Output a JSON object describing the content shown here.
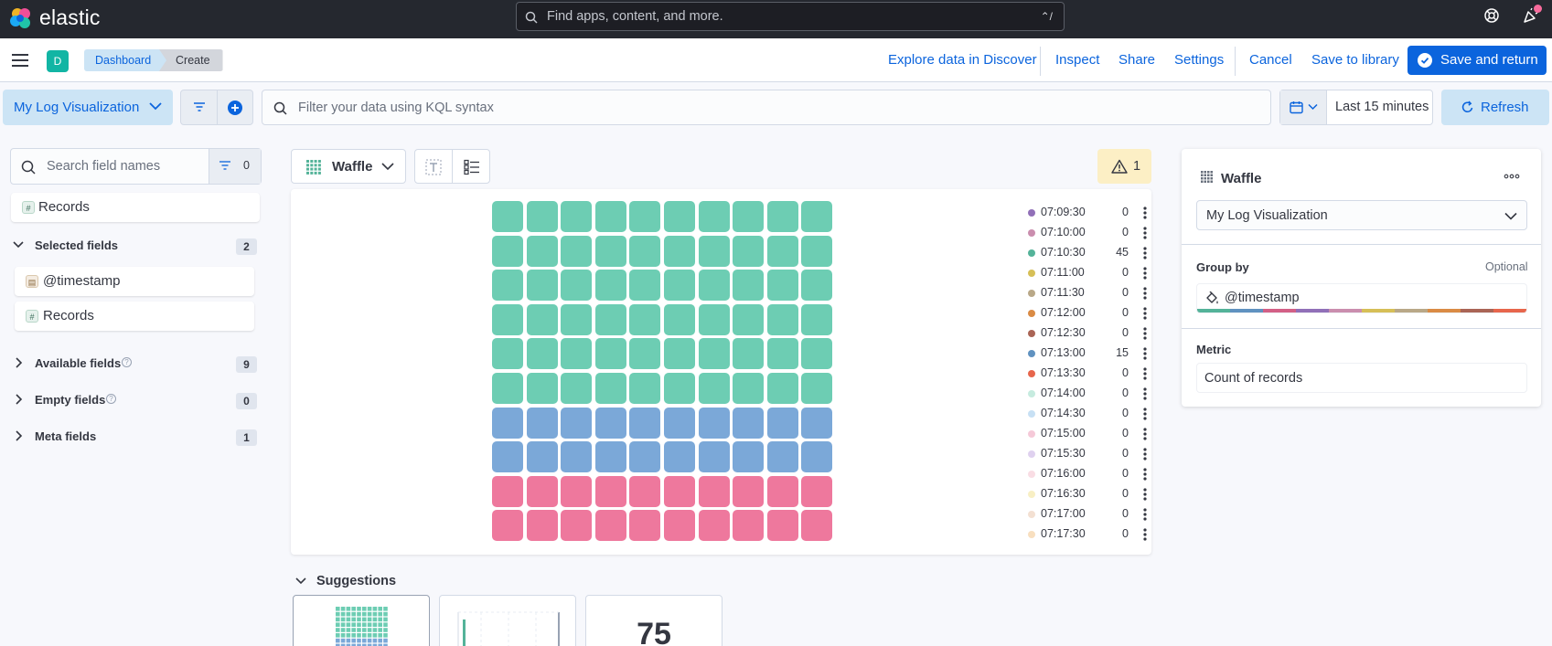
{
  "header": {
    "logo_text": "elastic",
    "search_placeholder": "Find apps, content, and more.",
    "search_shortcut": "⌃/"
  },
  "appbar": {
    "space_initial": "D",
    "breadcrumbs": [
      "Dashboard",
      "Create"
    ],
    "actions": {
      "explore": "Explore data in Discover",
      "inspect": "Inspect",
      "share": "Share",
      "settings": "Settings",
      "cancel": "Cancel",
      "save_library": "Save to library",
      "save_return": "Save and return"
    }
  },
  "querybar": {
    "viz_title": "My Log Visualization",
    "kql_placeholder": "Filter your data using KQL syntax",
    "date_range": "Last 15 minutes",
    "refresh": "Refresh"
  },
  "fields_panel": {
    "search_placeholder": "Search field names",
    "filter_count": "0",
    "records_top": "Records",
    "selected": {
      "label": "Selected fields",
      "count": "2",
      "items": [
        "@timestamp",
        "Records"
      ]
    },
    "available": {
      "label": "Available fields",
      "count": "9"
    },
    "empty": {
      "label": "Empty fields",
      "count": "0"
    },
    "meta": {
      "label": "Meta fields",
      "count": "1"
    }
  },
  "workspace": {
    "chart_type": "Waffle",
    "warnings_count": "1",
    "suggestions_label": "Suggestions",
    "suggestion_metric_value": "75"
  },
  "chart_data": {
    "type": "waffle",
    "grid": [
      10,
      10
    ],
    "legend": [
      {
        "label": "07:09:30",
        "value": 0,
        "color": "#9170b8"
      },
      {
        "label": "07:10:00",
        "value": 0,
        "color": "#ca8eae"
      },
      {
        "label": "07:10:30",
        "value": 45,
        "color": "#54b399"
      },
      {
        "label": "07:11:00",
        "value": 0,
        "color": "#d6bf57"
      },
      {
        "label": "07:11:30",
        "value": 0,
        "color": "#b9a888"
      },
      {
        "label": "07:12:00",
        "value": 0,
        "color": "#da8b45"
      },
      {
        "label": "07:12:30",
        "value": 0,
        "color": "#aa6556"
      },
      {
        "label": "07:13:00",
        "value": 15,
        "color": "#6092c0"
      },
      {
        "label": "07:13:30",
        "value": 0,
        "color": "#e7664c"
      },
      {
        "label": "07:14:00",
        "value": 0,
        "color": "#c6ebdf"
      },
      {
        "label": "07:14:30",
        "value": 0,
        "color": "#c7e0f4"
      },
      {
        "label": "07:15:00",
        "value": 0,
        "color": "#f5c9d8"
      },
      {
        "label": "07:15:30",
        "value": 0,
        "color": "#dfd1ef"
      },
      {
        "label": "07:16:00",
        "value": 0,
        "color": "#f9dde4"
      },
      {
        "label": "07:16:30",
        "value": 0,
        "color": "#f8efc4"
      },
      {
        "label": "07:17:00",
        "value": 0,
        "color": "#f3e0d2"
      },
      {
        "label": "07:17:30",
        "value": 0,
        "color": "#f8dfbf"
      }
    ],
    "cells": [
      {
        "rows": 6,
        "color": "#6dcdb3"
      },
      {
        "rows": 2,
        "color": "#7ba8d8"
      },
      {
        "rows": 2,
        "color": "#ee789d"
      }
    ]
  },
  "config_panel": {
    "title": "Waffle",
    "layer": "My Log Visualization",
    "group_by_label": "Group by",
    "optional_label": "Optional",
    "group_by_field": "@timestamp",
    "metric_label": "Metric",
    "metric_value": "Count of records",
    "palette": [
      "#54b399",
      "#6092c0",
      "#d36086",
      "#9170b8",
      "#ca8eae",
      "#d6bf57",
      "#b9a888",
      "#da8b45",
      "#aa6556",
      "#e7664c"
    ]
  }
}
